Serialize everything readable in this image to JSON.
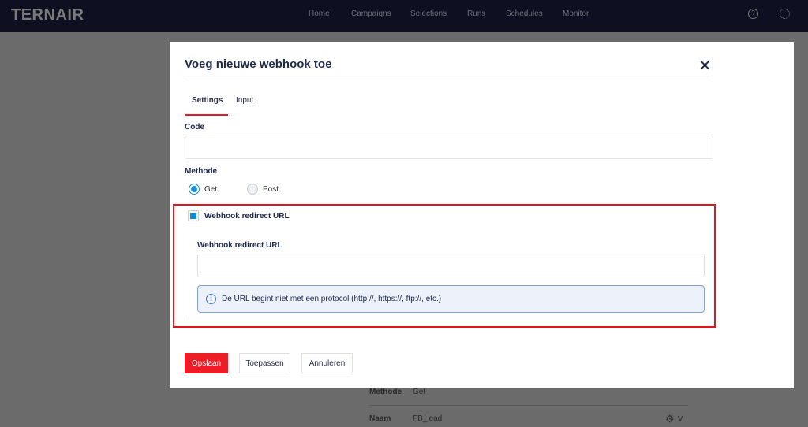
{
  "header": {
    "logo": "TERNAIR",
    "nav": [
      "Home",
      "Campaigns",
      "Selections",
      "Runs",
      "Schedules",
      "Monitor"
    ],
    "help_icon": "help-circle-icon",
    "settings_icon": "gear-icon"
  },
  "background": {
    "rows": [
      {
        "label": "Methode",
        "value": "Get"
      },
      {
        "label": "Naam",
        "value": "FB_lead"
      }
    ]
  },
  "modal": {
    "title": "Voeg nieuwe webhook toe",
    "tabs": [
      "Settings",
      "Input"
    ],
    "active_tab": "Settings",
    "code_label": "Code",
    "code_value": "",
    "method_label": "Methode",
    "methods": [
      "Get",
      "Post"
    ],
    "selected_method": "Get",
    "redirect_checkbox_label": "Webhook redirect URL",
    "redirect_checked": true,
    "redirect_field_label": "Webhook redirect URL",
    "redirect_value": "",
    "info_message": "De URL begint niet met een protocol (http://, https://, ftp://, etc.)",
    "buttons": {
      "save": "Opslaan",
      "apply": "Toepassen",
      "cancel": "Annuleren"
    }
  },
  "colors": {
    "accent": "#ef1c25",
    "primary": "#0d8fd8",
    "header": "#0e1021"
  }
}
